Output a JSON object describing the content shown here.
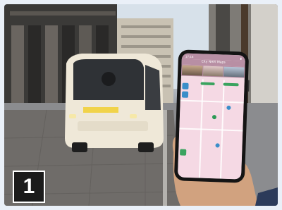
{
  "badge": {
    "number": "1"
  },
  "phone": {
    "time": "17:16",
    "app_title": "City NAVI Maps"
  },
  "colors": {
    "badge_bg": "#1b1b1b",
    "shuttle": "#efe8d8",
    "map_pink": "#f5d9e4",
    "app_header": "#b88fa4"
  }
}
